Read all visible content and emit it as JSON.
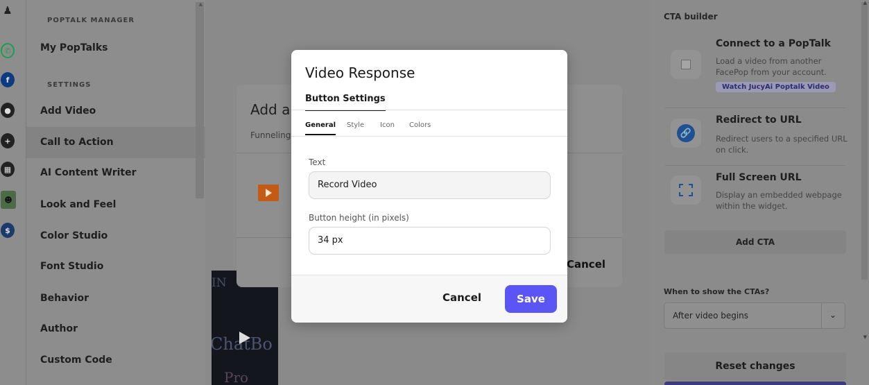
{
  "rail": {
    "icons": [
      "avatar-icon",
      "whatsapp-icon",
      "facebook-icon",
      "user-icon",
      "plus-icon",
      "document-icon",
      "bot-icon",
      "dollar-icon"
    ]
  },
  "sidebar": {
    "section_manager": "POPTALK MANAGER",
    "my_poptalks": "My PopTalks",
    "section_settings": "SETTINGS",
    "items": [
      {
        "label": "Add Video"
      },
      {
        "label": "Call to Action"
      },
      {
        "label": "AI Content Writer"
      },
      {
        "label": "Look and Feel"
      },
      {
        "label": "Color Studio"
      },
      {
        "label": "Font Studio"
      },
      {
        "label": "Behavior"
      },
      {
        "label": "Author"
      },
      {
        "label": "Custom Code"
      }
    ],
    "active_item": "Call to Action"
  },
  "background_modal": {
    "title": "Add a",
    "subtitle": "Funneling",
    "cancel_label": "Cancel"
  },
  "modal": {
    "title": "Video Response",
    "tab": "Button Settings",
    "subtabs": [
      "General",
      "Style",
      "Icon",
      "Colors"
    ],
    "active_subtab": "General",
    "text_label": "Text",
    "text_value": "Record Video",
    "height_label": "Button height (in pixels)",
    "height_value": "34 px",
    "cancel_label": "Cancel",
    "save_label": "Save",
    "colors": {
      "save": "#5a55f4"
    }
  },
  "right_panel": {
    "heading": "CTA builder",
    "cards": [
      {
        "title": "Connect to a PopTalk",
        "desc": "Load a video from another FacePop from your account.",
        "badge": "Watch JucyAi Poptalk Video",
        "icon": "image-placeholder-icon"
      },
      {
        "title": "Redirect to URL",
        "desc": "Redirect users to a specified URL on click.",
        "icon": "link-icon"
      },
      {
        "title": "Full Screen URL",
        "desc": "Display an embedded webpage within the widget.",
        "icon": "fullscreen-icon"
      }
    ],
    "add_cta_label": "Add CTA",
    "when_label": "When to show the CTAs?",
    "when_value": "After video begins",
    "reset_label": "Reset changes"
  }
}
